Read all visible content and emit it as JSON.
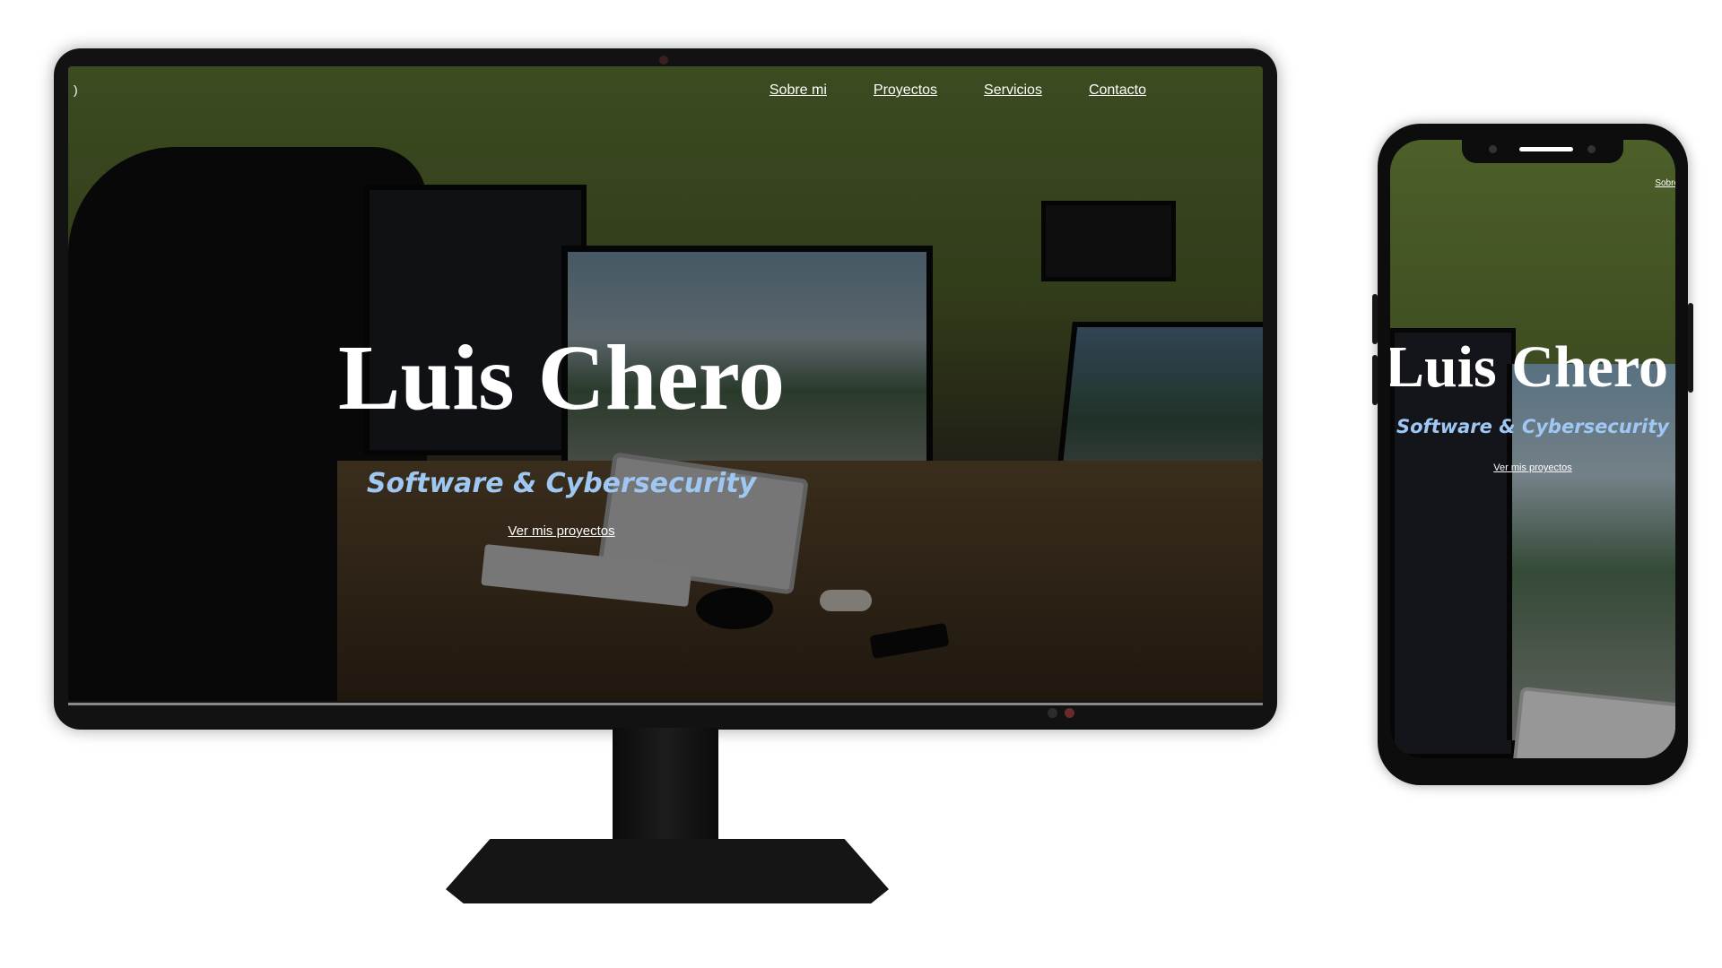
{
  "site": {
    "menu_toggle_glyph": ")",
    "nav": {
      "about": "Sobre mi",
      "projects": "Proyectos",
      "services": "Servicios",
      "contact": "Contacto"
    },
    "hero": {
      "title": "Luis Chero",
      "subtitle": "Software & Cybersecurity",
      "cta": "Ver mis proyectos"
    }
  },
  "mobile": {
    "nav_visible_label": "Sobre",
    "hero": {
      "title": "Luis Chero",
      "subtitle": "Software & Cybersecurity",
      "cta": "Ver mis proyectos"
    }
  },
  "colors": {
    "subtitle": "#9ec7f3",
    "nav_text": "#ffffff",
    "frame": "#121212"
  },
  "icons": {
    "menu": "menu-toggle-icon"
  }
}
